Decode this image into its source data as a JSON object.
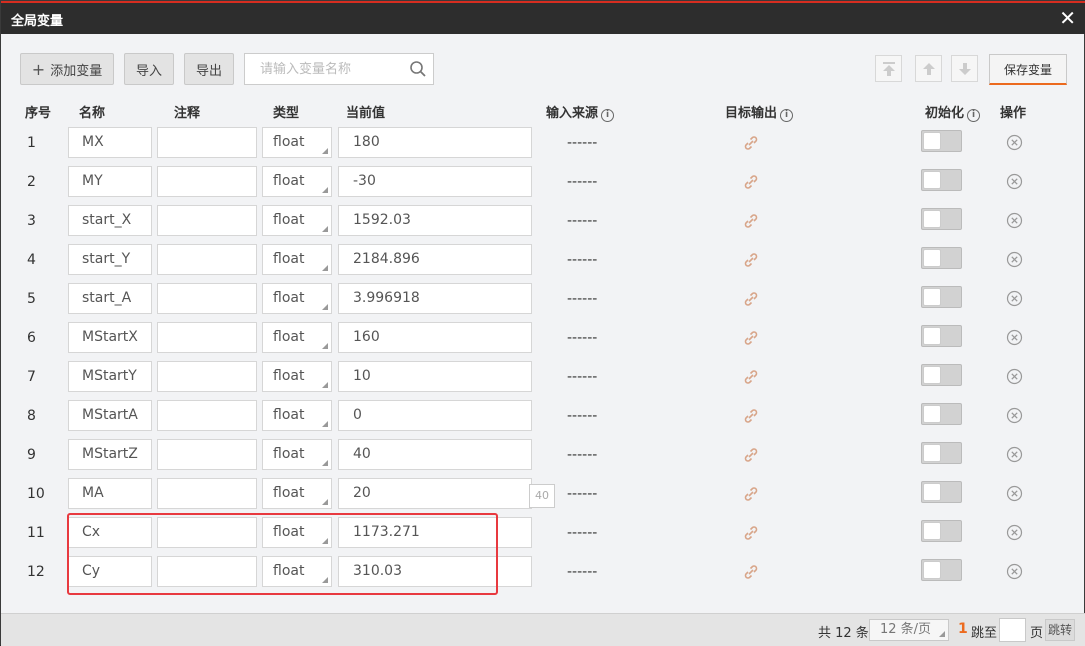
{
  "window": {
    "title": "全局变量",
    "close_glyph": "✕"
  },
  "toolbar": {
    "add_glyph": "+",
    "add_label": "添加变量",
    "import_label": "导入",
    "export_label": "导出",
    "search_placeholder": "请输入变量名称",
    "save_label": "保存变量"
  },
  "columns": {
    "index": "序号",
    "name": "名称",
    "note": "注释",
    "type": "类型",
    "value": "当前值",
    "source": "输入来源",
    "target": "目标输出",
    "init": "初始化",
    "action": "操作"
  },
  "rows": [
    {
      "index": "1",
      "name": "MX",
      "note": "",
      "type": "float",
      "value": "180",
      "source": "------",
      "init": false
    },
    {
      "index": "2",
      "name": "MY",
      "note": "",
      "type": "float",
      "value": "-30",
      "source": "------",
      "init": false
    },
    {
      "index": "3",
      "name": "start_X",
      "note": "",
      "type": "float",
      "value": "1592.03",
      "source": "------",
      "init": false
    },
    {
      "index": "4",
      "name": "start_Y",
      "note": "",
      "type": "float",
      "value": "2184.896",
      "source": "------",
      "init": false
    },
    {
      "index": "5",
      "name": "start_A",
      "note": "",
      "type": "float",
      "value": "3.996918",
      "source": "------",
      "init": false
    },
    {
      "index": "6",
      "name": "MStartX",
      "note": "",
      "type": "float",
      "value": "160",
      "source": "------",
      "init": false
    },
    {
      "index": "7",
      "name": "MStartY",
      "note": "",
      "type": "float",
      "value": "10",
      "source": "------",
      "init": false
    },
    {
      "index": "8",
      "name": "MStartA",
      "note": "",
      "type": "float",
      "value": "0",
      "source": "------",
      "init": false
    },
    {
      "index": "9",
      "name": "MStartZ",
      "note": "",
      "type": "float",
      "value": "40",
      "source": "------",
      "init": false
    },
    {
      "index": "10",
      "name": "MA",
      "note": "",
      "type": "float",
      "value": "20",
      "source": "------",
      "init": false
    },
    {
      "index": "11",
      "name": "Cx",
      "note": "",
      "type": "float",
      "value": "1173.271",
      "source": "------",
      "init": false
    },
    {
      "index": "12",
      "name": "Cy",
      "note": "",
      "type": "float",
      "value": "310.03",
      "source": "------",
      "init": false
    }
  ],
  "value_hint": "40",
  "footer": {
    "total_prefix": "共 12 条",
    "page_size": "12 条/页",
    "current_page": "1",
    "jump_to": "跳至",
    "page_word": "页",
    "jump_button": "跳转"
  },
  "colors": {
    "accent": "#ec6a1e",
    "highlight": "#e8393f",
    "titlebar": "#2d2d2d"
  }
}
